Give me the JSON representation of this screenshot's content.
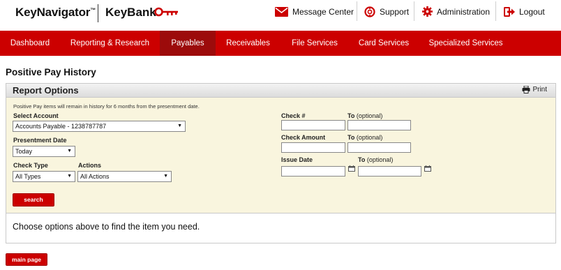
{
  "header": {
    "brand_keynavigator": "KeyNavigator",
    "brand_tm": "™",
    "brand_keybank": "KeyBank",
    "message_center": "Message Center",
    "support": "Support",
    "administration": "Administration",
    "logout": "Logout"
  },
  "nav": {
    "tabs": [
      {
        "label": "Dashboard"
      },
      {
        "label": "Reporting & Research"
      },
      {
        "label": "Payables"
      },
      {
        "label": "Receivables"
      },
      {
        "label": "File Services"
      },
      {
        "label": "Card Services"
      },
      {
        "label": "Specialized Services"
      }
    ],
    "active": "Payables"
  },
  "page": {
    "title": "Positive Pay History"
  },
  "report_options": {
    "title": "Report Options",
    "print_label": "Print",
    "note": "Positive Pay items will remain in history for 6 months from the presentment date.",
    "select_account_label": "Select Account",
    "select_account_value": "Accounts Payable - 1238787787",
    "presentment_date_label": "Presentment Date",
    "presentment_date_value": "Today",
    "check_type_label": "Check Type",
    "check_type_value": "All Types",
    "actions_label": "Actions",
    "actions_value": "All Actions",
    "check_num_label": "Check #",
    "check_amount_label": "Check Amount",
    "issue_date_label": "Issue Date",
    "to_label": "To",
    "optional_label": "(optional)",
    "search_button": "search"
  },
  "message": "Choose options above to find the item you need.",
  "footer": {
    "main_page_button": "main page"
  },
  "colors": {
    "brand_red": "#cc0000",
    "active_tab": "#9c0b0b",
    "panel_bg": "#f9f5de"
  }
}
